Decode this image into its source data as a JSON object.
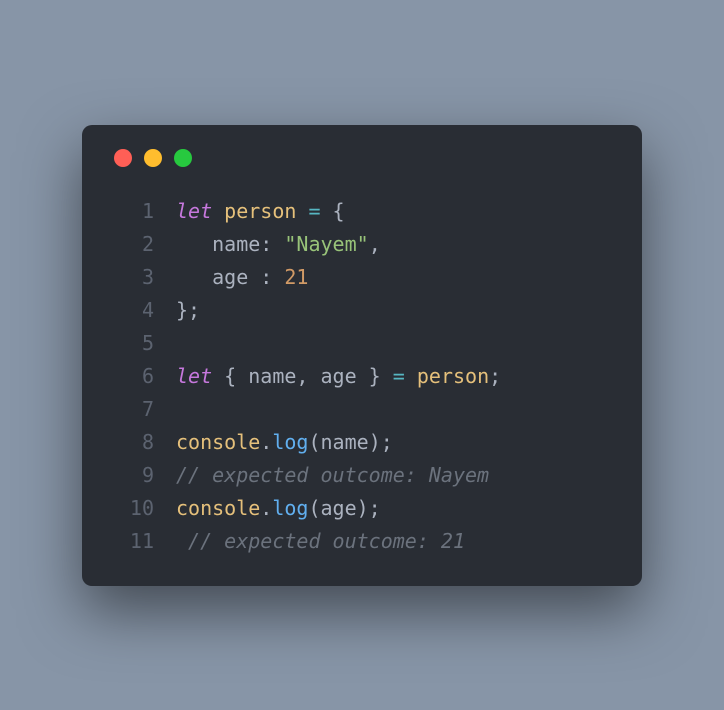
{
  "window": {
    "traffic_lights": [
      "red",
      "yellow",
      "green"
    ]
  },
  "code": {
    "lines": [
      {
        "n": "1",
        "tokens": [
          {
            "t": "let",
            "c": "kw"
          },
          {
            "t": " ",
            "c": "txt"
          },
          {
            "t": "person",
            "c": "var"
          },
          {
            "t": " ",
            "c": "txt"
          },
          {
            "t": "=",
            "c": "op"
          },
          {
            "t": " {",
            "c": "punc"
          }
        ]
      },
      {
        "n": "2",
        "tokens": [
          {
            "t": "   ",
            "c": "txt"
          },
          {
            "t": "name",
            "c": "prop"
          },
          {
            "t": ":",
            "c": "punc"
          },
          {
            "t": " ",
            "c": "txt"
          },
          {
            "t": "\"Nayem\"",
            "c": "str"
          },
          {
            "t": ",",
            "c": "punc"
          }
        ]
      },
      {
        "n": "3",
        "tokens": [
          {
            "t": "   ",
            "c": "txt"
          },
          {
            "t": "age",
            "c": "prop"
          },
          {
            "t": " ",
            "c": "txt"
          },
          {
            "t": ":",
            "c": "punc"
          },
          {
            "t": " ",
            "c": "txt"
          },
          {
            "t": "21",
            "c": "num"
          }
        ]
      },
      {
        "n": "4",
        "tokens": [
          {
            "t": "};",
            "c": "punc"
          }
        ]
      },
      {
        "n": "5",
        "tokens": []
      },
      {
        "n": "6",
        "tokens": [
          {
            "t": "let",
            "c": "kw"
          },
          {
            "t": " { ",
            "c": "punc"
          },
          {
            "t": "name",
            "c": "prop"
          },
          {
            "t": ",",
            "c": "punc"
          },
          {
            "t": " ",
            "c": "txt"
          },
          {
            "t": "age",
            "c": "prop"
          },
          {
            "t": " } ",
            "c": "punc"
          },
          {
            "t": "=",
            "c": "op"
          },
          {
            "t": " ",
            "c": "txt"
          },
          {
            "t": "person",
            "c": "var"
          },
          {
            "t": ";",
            "c": "punc"
          }
        ]
      },
      {
        "n": "7",
        "tokens": []
      },
      {
        "n": "8",
        "tokens": [
          {
            "t": "console",
            "c": "obj"
          },
          {
            "t": ".",
            "c": "punc"
          },
          {
            "t": "log",
            "c": "fn"
          },
          {
            "t": "(",
            "c": "punc"
          },
          {
            "t": "name",
            "c": "prop"
          },
          {
            "t": ");",
            "c": "punc"
          }
        ]
      },
      {
        "n": "9",
        "tokens": [
          {
            "t": "// expected outcome: Nayem",
            "c": "comment"
          }
        ]
      },
      {
        "n": "10",
        "tokens": [
          {
            "t": "console",
            "c": "obj"
          },
          {
            "t": ".",
            "c": "punc"
          },
          {
            "t": "log",
            "c": "fn"
          },
          {
            "t": "(",
            "c": "punc"
          },
          {
            "t": "age",
            "c": "prop"
          },
          {
            "t": ");",
            "c": "punc"
          }
        ]
      },
      {
        "n": "11",
        "tokens": [
          {
            "t": " // expected outcome: 21",
            "c": "comment"
          }
        ]
      }
    ]
  }
}
